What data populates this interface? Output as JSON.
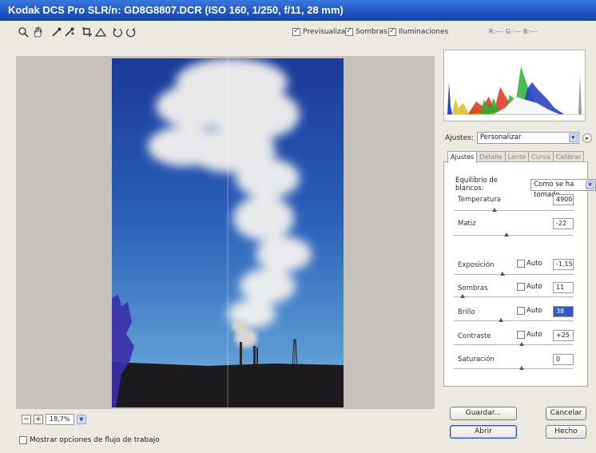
{
  "window": {
    "title": "Kodak DCS Pro SLR/n:  GD8G8807.DCR  (ISO 160, 1/250, f/11, 28 mm)"
  },
  "toolbar": {
    "tools": [
      "zoom-icon",
      "hand-icon",
      "white-balance-eyedropper-icon",
      "color-sampler-icon",
      "crop-icon",
      "straighten-icon",
      "rotate-left-icon",
      "rotate-right-icon"
    ],
    "preview_label": "Previsualizar",
    "shadows_label": "Sombras",
    "highlights_label": "Iluminaciones",
    "rgb_readout": "R:---  G:---  B:---"
  },
  "zoom": {
    "value": "18,7%"
  },
  "workflow_label": "Mostrar opciones de flujo de trabajo",
  "settings": {
    "label": "Ajustes:",
    "value": "Personalizar"
  },
  "tabs": [
    "Ajustes",
    "Detalle",
    "Lente",
    "Curva",
    "Calibrar"
  ],
  "white_balance": {
    "label": "Equilibrio de blancos:",
    "value": "Como se ha tomado"
  },
  "sliders": {
    "temperature": {
      "label": "Temperatura",
      "value": "4900"
    },
    "tint": {
      "label": "Matiz",
      "value": "-22"
    },
    "exposure": {
      "label": "Exposición",
      "value": "-1,15",
      "auto": "Auto"
    },
    "shadows": {
      "label": "Sombras",
      "value": "11",
      "auto": "Auto"
    },
    "brightness": {
      "label": "Brillo",
      "value": "38",
      "auto": "Auto"
    },
    "contrast": {
      "label": "Contraste",
      "value": "+25",
      "auto": "Auto"
    },
    "saturation": {
      "label": "Saturación",
      "value": "0"
    }
  },
  "buttons": {
    "save": "Guardar...",
    "cancel": "Cancelar",
    "open": "Abrir",
    "done": "Hecho"
  },
  "colors": {
    "titlebar": "#1f56c4",
    "sky_top": "#1d3f9e",
    "sky_bottom": "#5a9fd6",
    "selection": "#3159c2"
  }
}
